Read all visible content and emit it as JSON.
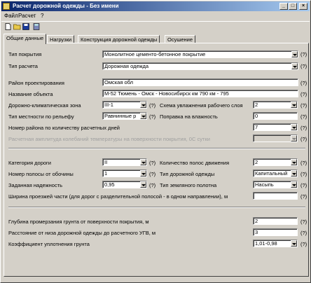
{
  "window": {
    "title": "Расчет дорожной одежды - Без имени",
    "minimize": "_",
    "maximize": "□",
    "close": "×"
  },
  "menu": [
    "Файл",
    "Расчет",
    "?"
  ],
  "toolbar": {
    "icons": [
      "new-file-icon",
      "open-folder-icon",
      "save-icon",
      "calculator-icon"
    ]
  },
  "tabs": [
    "Общие данные",
    "Нагрузки",
    "Конструкция дорожной одежды",
    "Осушение"
  ],
  "form": {
    "pavement_type": {
      "label": "Тип покрытия",
      "value": "Монолитное цементо-бетонное покрытие",
      "help": "(?)"
    },
    "calc_type": {
      "label": "Тип расчета",
      "value": "Дорожная одежда",
      "help": "(?)"
    },
    "design_area": {
      "label": "Район проектирования",
      "value": "Омская обл",
      "help": "(?)"
    },
    "object_name": {
      "label": "Название объекта",
      "value": "М-52 Тюмень - Омск - Новосибирск км 790 км - 795",
      "help": "(?)"
    },
    "climate_zone": {
      "label": "Дорожно-климатическая зона",
      "value": "III-1",
      "help": "(?)"
    },
    "moisture_scheme": {
      "label": "Схема увлажнения рабочего слоя",
      "value": "2",
      "help": "(?)"
    },
    "terrain_type": {
      "label": "Тип местности по рельефу",
      "value": "Равнинные р",
      "help": "(?)"
    },
    "moisture_correction": {
      "label": "Поправка на влажность",
      "value": "0",
      "help": "(?)"
    },
    "region_number": {
      "label": "Номер района по количеству расчетных дней",
      "value": "7",
      "help": "(?)"
    },
    "temp_amplitude": {
      "label": "Расчетная амплитуда колебаний температуры на поверхности покрытия, 0С сутки",
      "value": "",
      "help": "(?)"
    },
    "road_category": {
      "label": "Категория дороги",
      "value": "II",
      "help": "(?)"
    },
    "lanes_count": {
      "label": "Количество полос движения",
      "value": "2",
      "help": "(?)"
    },
    "lane_from_edge": {
      "label": "Номер полосы от обочины",
      "value": "1",
      "help": "(?)"
    },
    "pavement_kind": {
      "label": "Тип дорожной одежды",
      "value": "Капитальный",
      "help": "(?)"
    },
    "reliability": {
      "label": "Заданная надежность",
      "value": "0,95",
      "help": "(?)"
    },
    "subgrade_type": {
      "label": "Тип земляного полотна",
      "value": "Насыпь",
      "help": "(?)"
    },
    "carriageway_width": {
      "label": "Ширина проезжей части (для дорог с разделительной полосой - в одном направлении), м",
      "value": "",
      "help": "(?)"
    },
    "freeze_depth": {
      "label": "Глубина промерзания грунта от поверхности покрытия, м",
      "value": "2",
      "help": "(?)"
    },
    "distance_ugv": {
      "label": "Расстояние от низа дорожной одежды до расчетного УГВ, м",
      "value": "3",
      "help": "(?)"
    },
    "compaction_coef": {
      "label": "Коэффициент уплотнения грунта",
      "value": "1,01-0,98",
      "help": "(?)"
    }
  }
}
